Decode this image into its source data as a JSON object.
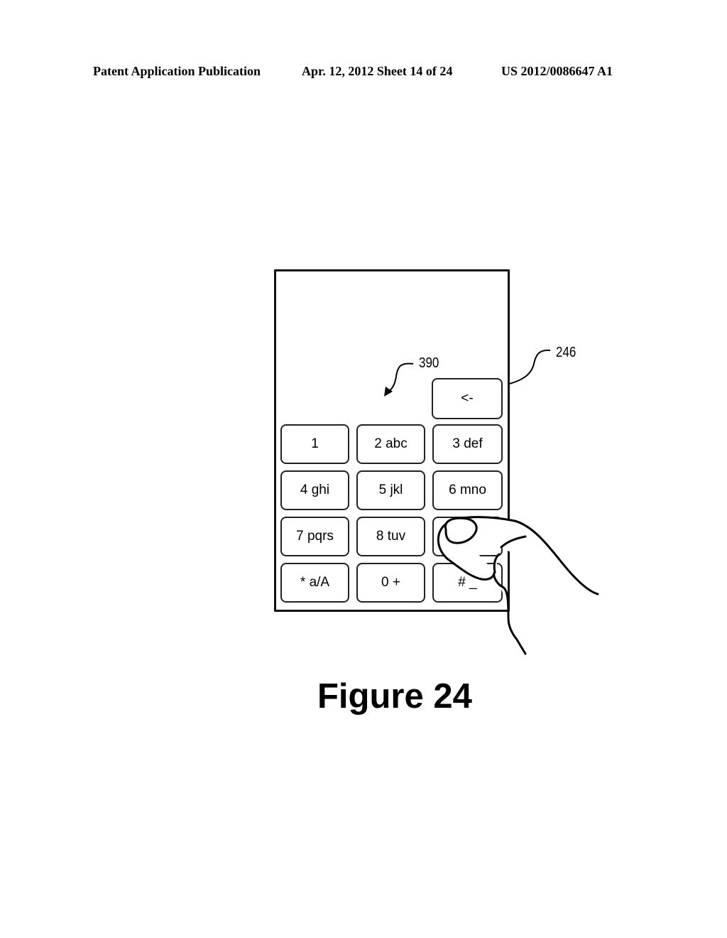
{
  "header": {
    "publication": "Patent Application Publication",
    "date_sheet": "Apr. 12, 2012  Sheet 14 of 24",
    "patent_number": "US 2012/0086647 A1"
  },
  "figure": {
    "caption": "Figure 24",
    "ref_device": "246",
    "ref_keypad": "390"
  },
  "keypad": {
    "backspace": "<-",
    "keys": [
      "1",
      "2 abc",
      "3 def",
      "4 ghi",
      "5 jkl",
      "6 mno",
      "7 pqrs",
      "8 tuv",
      "",
      "* a/A",
      "0 +",
      "# _"
    ]
  }
}
